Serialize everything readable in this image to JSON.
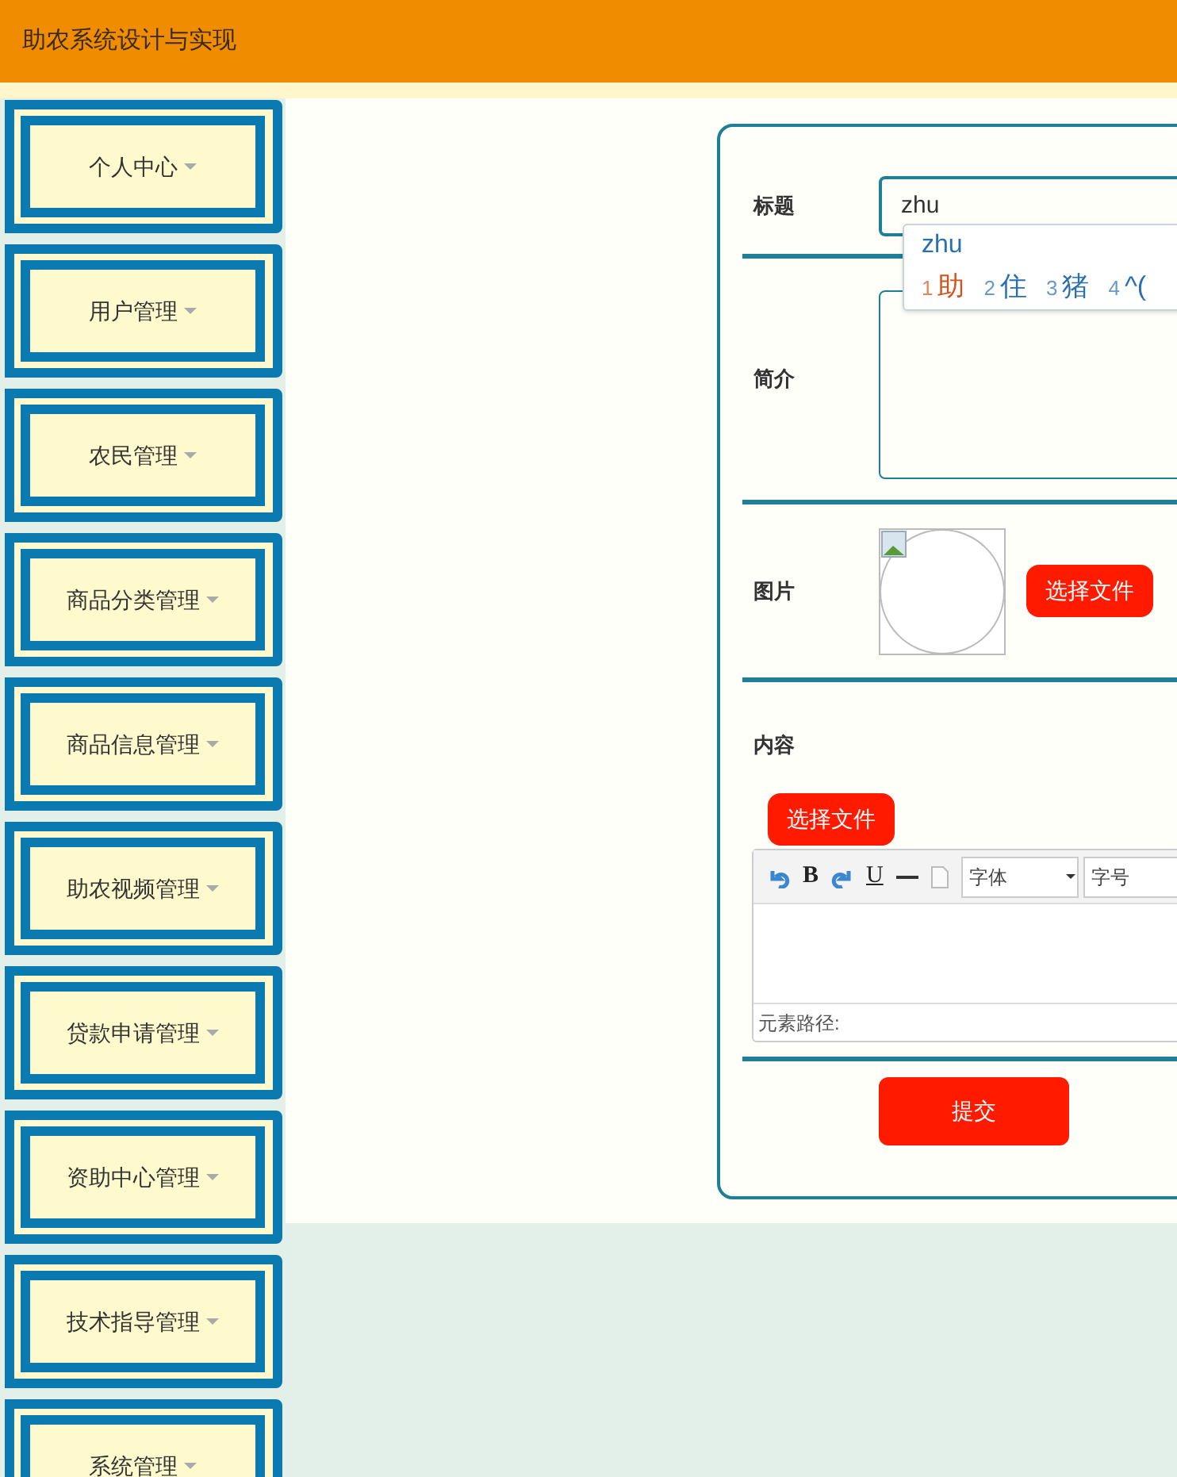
{
  "header": {
    "title": "助农系统设计与实现"
  },
  "sidebar": {
    "items": [
      {
        "label": "个人中心"
      },
      {
        "label": "用户管理"
      },
      {
        "label": "农民管理"
      },
      {
        "label": "商品分类管理"
      },
      {
        "label": "商品信息管理"
      },
      {
        "label": "助农视频管理"
      },
      {
        "label": "贷款申请管理"
      },
      {
        "label": "资助中心管理"
      },
      {
        "label": "技术指导管理"
      },
      {
        "label": "系统管理"
      }
    ]
  },
  "form": {
    "fields": [
      {
        "kind": "text",
        "label": "标题",
        "value": "zhu"
      },
      {
        "kind": "textarea",
        "label": "简介"
      },
      {
        "kind": "image",
        "label": "图片",
        "button": "选择文件"
      },
      {
        "kind": "editor",
        "label": "内容",
        "button": "选择文件",
        "bold": "B",
        "underline": "U",
        "font": "字体",
        "size": "字号",
        "path_label": "元素路径:"
      }
    ],
    "submit": "提交"
  },
  "ime": {
    "composition": "zhu",
    "candidates": [
      {
        "index": "1",
        "text": "助",
        "selected": true
      },
      {
        "index": "2",
        "text": "住",
        "selected": false
      },
      {
        "index": "3",
        "text": "猪",
        "selected": false
      },
      {
        "index": "4",
        "text": "^(",
        "selected": false
      }
    ]
  }
}
